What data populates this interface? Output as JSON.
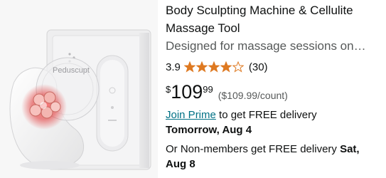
{
  "product": {
    "title": "Body Sculpting Machine & Cellulite Massage Tool",
    "subtitle": "Designed for massage sessions on…",
    "image": {
      "brand_text": "Peduscupt"
    },
    "rating": {
      "value": "3.9",
      "stars_filled": 3.9,
      "review_count": "(30)"
    },
    "price": {
      "symbol": "$",
      "whole": "109",
      "fraction": "99",
      "unit_price": "($109.99/count)"
    },
    "delivery": {
      "prime_link": "Join Prime",
      "prime_text": " to get FREE delivery",
      "prime_date": "Tomorrow, Aug 4",
      "nonmember_text": "Or Non-members get FREE delivery ",
      "nonmember_date": "Sat, Aug 8"
    }
  },
  "colors": {
    "star": "#DE7921",
    "link": "#007185",
    "secondary_text": "#565959",
    "primary_text": "#0F1111"
  }
}
